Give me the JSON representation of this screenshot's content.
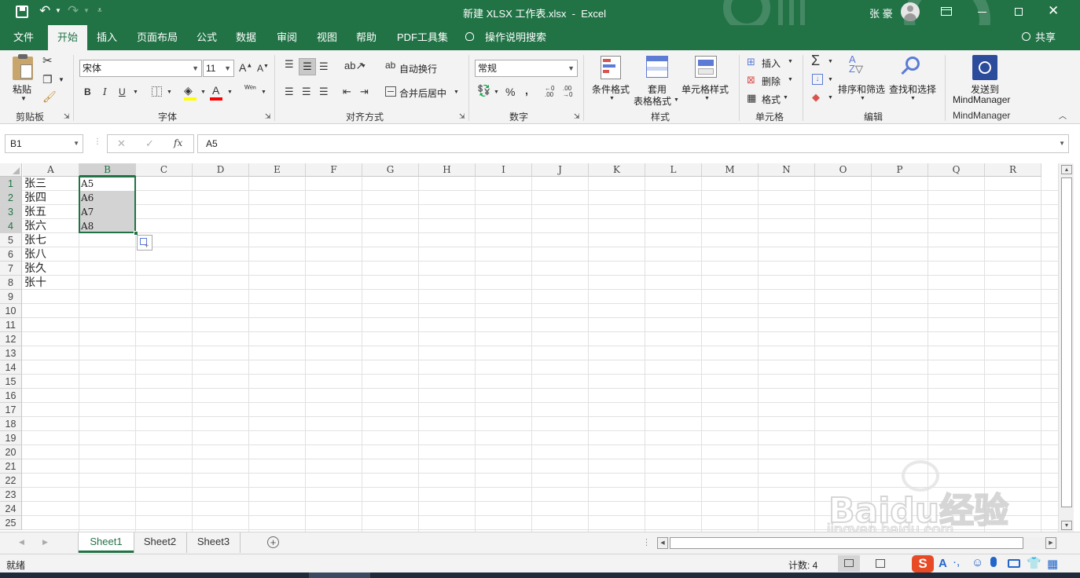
{
  "titlebar": {
    "doc_title": "新建 XLSX 工作表.xlsx  -  Excel",
    "user_name": "张 豪",
    "save_icon": "save-icon",
    "undo_icon": "undo-icon",
    "redo_icon": "redo-icon"
  },
  "tabs": [
    "文件",
    "开始",
    "插入",
    "页面布局",
    "公式",
    "数据",
    "审阅",
    "视图",
    "帮助",
    "PDF工具集"
  ],
  "tell_me": "操作说明搜索",
  "share": "共享",
  "ribbon": {
    "clipboard": {
      "paste": "粘贴",
      "label": "剪贴板"
    },
    "font": {
      "name": "宋体",
      "size": "11",
      "bold": "B",
      "italic": "I",
      "underline": "U",
      "label": "字体"
    },
    "align": {
      "wrap": "自动换行",
      "merge": "合并后居中",
      "label": "对齐方式"
    },
    "number": {
      "format": "常规",
      "percent": "%",
      "comma": ",",
      "label": "数字"
    },
    "styles": {
      "cond": "条件格式",
      "table1": "套用",
      "table2": "表格格式",
      "cell": "单元格样式",
      "label": "样式"
    },
    "cells": {
      "insert": "插入",
      "delete": "删除",
      "format": "格式",
      "label": "单元格"
    },
    "editing": {
      "sort": "排序和筛选",
      "find": "查找和选择",
      "label": "编辑"
    },
    "mindmanager": {
      "send1": "发送到",
      "send2": "MindManager",
      "label": "MindManager"
    }
  },
  "formula_bar": {
    "name_box": "B1",
    "cancel": "✕",
    "confirm": "✓",
    "fx": "fx",
    "value": "A5"
  },
  "columns": [
    "A",
    "B",
    "C",
    "D",
    "E",
    "F",
    "G",
    "H",
    "I",
    "J",
    "K",
    "L",
    "M",
    "N",
    "O",
    "P",
    "Q",
    "R"
  ],
  "rows": [
    "1",
    "2",
    "3",
    "4",
    "5",
    "6",
    "7",
    "8",
    "9",
    "10",
    "11",
    "12",
    "13",
    "14",
    "15",
    "16",
    "17",
    "18",
    "19",
    "20",
    "21",
    "22",
    "23",
    "24",
    "25"
  ],
  "colA": [
    "张三",
    "张四",
    "张五",
    "张六",
    "张七",
    "张八",
    "张久",
    "张十"
  ],
  "colB": [
    "A5",
    "A6",
    "A7",
    "A8"
  ],
  "sheets": [
    "Sheet1",
    "Sheet2",
    "Sheet3"
  ],
  "status": {
    "ready": "就绪",
    "count": "计数: 4"
  },
  "watermark": {
    "logo": "Baidu经验",
    "url": "jingyan.baidu.com"
  },
  "colors": {
    "accent": "#217346",
    "selection": "#d3d3d3",
    "grid": "#e1e1e1"
  }
}
